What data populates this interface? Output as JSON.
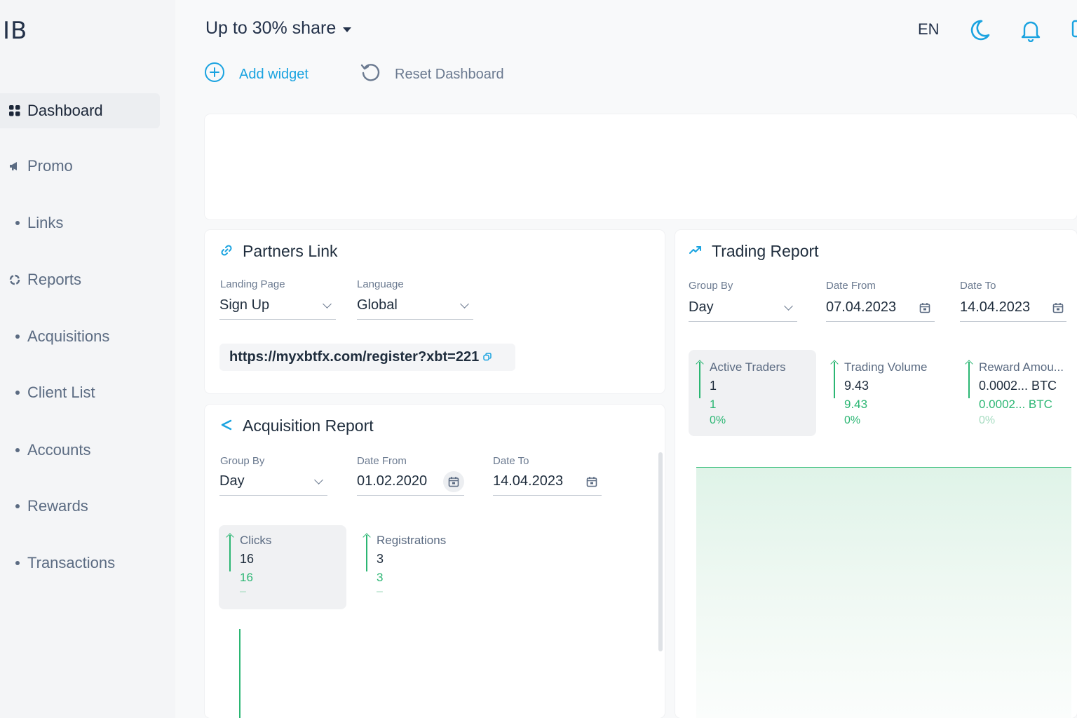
{
  "app": {
    "logo": "IB"
  },
  "sidebar": {
    "items": [
      {
        "label": "Dashboard",
        "icon": "grid-icon",
        "active": true
      },
      {
        "label": "Promo",
        "icon": "megaphone-icon"
      },
      {
        "label": "Links",
        "icon": "bullet"
      },
      {
        "label": "Reports",
        "icon": "pie-chart-icon"
      },
      {
        "label": "Acquisitions",
        "icon": "bullet"
      },
      {
        "label": "Client List",
        "icon": "bullet"
      },
      {
        "label": "Accounts",
        "icon": "bullet"
      },
      {
        "label": "Rewards",
        "icon": "bullet"
      },
      {
        "label": "Transactions",
        "icon": "bullet"
      }
    ]
  },
  "header": {
    "share_selector": "Up to 30% share",
    "language": "EN",
    "icons": [
      "moon-icon",
      "bell-icon"
    ]
  },
  "actions": {
    "add_widget": "Add widget",
    "reset_dashboard": "Reset Dashboard"
  },
  "partners_link": {
    "title": "Partners Link",
    "landing_page": {
      "label": "Landing Page",
      "value": "Sign Up"
    },
    "language": {
      "label": "Language",
      "value": "Global"
    },
    "url": "https://myxbtfx.com/register?xbt=221"
  },
  "acquisition_report": {
    "title": "Acquisition Report",
    "group_by": {
      "label": "Group By",
      "value": "Day"
    },
    "date_from": {
      "label": "Date From",
      "value": "01.02.2020"
    },
    "date_to": {
      "label": "Date To",
      "value": "14.04.2023"
    },
    "stats": [
      {
        "label": "Clicks",
        "value": "16",
        "compare": "16",
        "change": "–"
      },
      {
        "label": "Registrations",
        "value": "3",
        "compare": "3",
        "change": "–"
      }
    ]
  },
  "trading_report": {
    "title": "Trading Report",
    "group_by": {
      "label": "Group By",
      "value": "Day"
    },
    "date_from": {
      "label": "Date From",
      "value": "07.04.2023"
    },
    "date_to": {
      "label": "Date To",
      "value": "14.04.2023"
    },
    "stats": [
      {
        "label": "Active Traders",
        "value": "1",
        "compare": "1",
        "change": "0%"
      },
      {
        "label": "Trading Volume",
        "value": "9.43",
        "compare": "9.43",
        "change": "0%"
      },
      {
        "label": "Reward Amou...",
        "value": "0.0002... BTC",
        "compare": "0.0002... BTC",
        "change": "0%"
      }
    ]
  },
  "colors": {
    "accent": "#1aa3e0",
    "positive": "#2bb673",
    "text": "#1f2d3d",
    "muted": "#6b7a90"
  }
}
